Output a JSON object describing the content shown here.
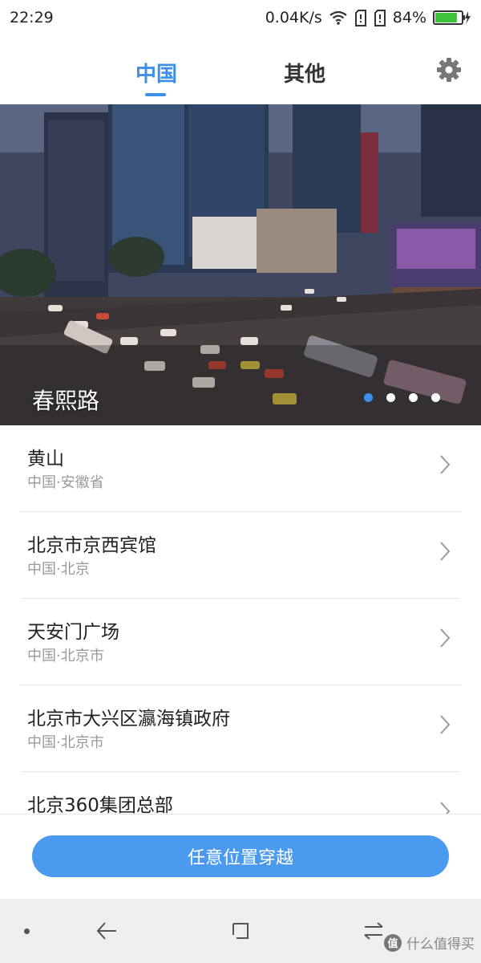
{
  "status_bar": {
    "time": "22:29",
    "network_speed": "0.04K/s",
    "battery_percent": "84%",
    "battery_level": 0.84,
    "icons": [
      "wifi-icon",
      "sim-card-icon",
      "sim-card-icon",
      "battery-charging-icon"
    ]
  },
  "tabs": [
    {
      "label": "中国",
      "active": true
    },
    {
      "label": "其他",
      "active": false
    }
  ],
  "settings_icon": "gear-icon",
  "banner": {
    "caption": "春熙路",
    "slide_count": 4,
    "active_index": 0
  },
  "locations": [
    {
      "title": "黄山",
      "subtitle": "中国·安徽省"
    },
    {
      "title": "北京市京西宾馆",
      "subtitle": "中国·北京"
    },
    {
      "title": "天安门广场",
      "subtitle": "中国·北京市"
    },
    {
      "title": "北京市大兴区瀛海镇政府",
      "subtitle": "中国·北京市"
    },
    {
      "title": "北京360集团总部",
      "subtitle": ""
    }
  ],
  "action_button": "任意位置穿越",
  "nav_bar": {
    "icons": [
      "back-icon",
      "recents-icon",
      "switch-icon"
    ]
  },
  "watermark": {
    "logo": "值",
    "text": "什么值得买"
  },
  "colors": {
    "accent": "#3d8fe8",
    "button": "#4a9af0",
    "subtitle": "#9a9a9a",
    "battery": "#3ac43a"
  }
}
